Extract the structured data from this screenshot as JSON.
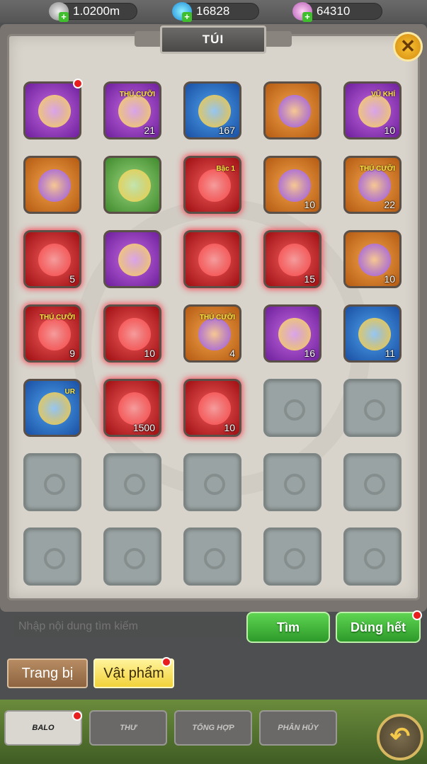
{
  "currencies": [
    {
      "label": "1.0200m",
      "icon": "silver-coin-icon",
      "color": "#bfbfbf"
    },
    {
      "label": "16828",
      "icon": "diamond-icon",
      "color": "#2fb0f0"
    },
    {
      "label": "64310",
      "icon": "pink-gem-icon",
      "color": "#d98ad9"
    }
  ],
  "panel": {
    "title": "TÚI",
    "close_label": "✕"
  },
  "items": [
    {
      "icon": "treasure-chest-icon",
      "color": "purple",
      "count": "",
      "tag": "",
      "badge": true
    },
    {
      "icon": "pet-egg-icon",
      "color": "purple",
      "count": "21",
      "tag": "THÚ CƯỠI",
      "badge": false
    },
    {
      "icon": "gold-flame-icon",
      "color": "blue",
      "count": "167",
      "tag": "",
      "badge": false
    },
    {
      "icon": "gold-orb-icon",
      "color": "orange",
      "count": "",
      "tag": "",
      "badge": false
    },
    {
      "icon": "weapon-egg-icon",
      "color": "purple",
      "count": "10",
      "tag": "VŨ KHÍ",
      "badge": false
    },
    {
      "icon": "puzzle-piece-icon",
      "color": "orange",
      "count": "",
      "tag": "",
      "badge": false
    },
    {
      "icon": "golden-egg-nest-icon",
      "color": "green",
      "count": "",
      "tag": "",
      "badge": false
    },
    {
      "icon": "red-swirl-orb-icon",
      "color": "red",
      "count": "",
      "tag": "Bậc 1",
      "badge": false
    },
    {
      "icon": "purple-orb-icon",
      "color": "orange",
      "count": "10",
      "tag": "",
      "badge": false
    },
    {
      "icon": "blue-fruit-icon",
      "color": "orange",
      "count": "22",
      "tag": "THÚ CƯỠI",
      "badge": false
    },
    {
      "icon": "key-icon",
      "color": "red",
      "count": "5",
      "tag": "",
      "badge": false
    },
    {
      "icon": "red-gem-icon",
      "color": "purple",
      "count": "",
      "tag": "",
      "badge": false
    },
    {
      "icon": "red-orb-icon",
      "color": "red",
      "count": "",
      "tag": "",
      "badge": false
    },
    {
      "icon": "potion-icon",
      "color": "red",
      "count": "15",
      "tag": "",
      "badge": false
    },
    {
      "icon": "rope-icon",
      "color": "orange",
      "count": "10",
      "tag": "",
      "badge": false
    },
    {
      "icon": "candy-icon",
      "color": "red",
      "count": "9",
      "tag": "THÚ CƯỠI",
      "badge": false
    },
    {
      "icon": "blue-scroll-icon",
      "color": "red",
      "count": "10",
      "tag": "",
      "badge": false
    },
    {
      "icon": "scroll-icon",
      "color": "orange",
      "count": "4",
      "tag": "THÚ CƯỠI",
      "badge": false
    },
    {
      "icon": "blue-orb-icon",
      "color": "purple",
      "count": "16",
      "tag": "",
      "badge": false
    },
    {
      "icon": "blue-rope-icon",
      "color": "blue",
      "count": "11",
      "tag": "",
      "badge": false
    },
    {
      "icon": "ur-character-icon",
      "color": "blue",
      "count": "",
      "tag": "UR",
      "badge": false
    },
    {
      "icon": "ruby-icon",
      "color": "red",
      "count": "1500",
      "tag": "",
      "badge": false
    },
    {
      "icon": "green-scroll-icon",
      "color": "red",
      "count": "10",
      "tag": "",
      "badge": false
    },
    {
      "icon": "",
      "color": "empty",
      "count": "",
      "tag": "",
      "badge": false
    },
    {
      "icon": "",
      "color": "empty",
      "count": "",
      "tag": "",
      "badge": false
    },
    {
      "icon": "",
      "color": "empty",
      "count": "",
      "tag": "",
      "badge": false
    },
    {
      "icon": "",
      "color": "empty",
      "count": "",
      "tag": "",
      "badge": false
    },
    {
      "icon": "",
      "color": "empty",
      "count": "",
      "tag": "",
      "badge": false
    },
    {
      "icon": "",
      "color": "empty",
      "count": "",
      "tag": "",
      "badge": false
    },
    {
      "icon": "",
      "color": "empty",
      "count": "",
      "tag": "",
      "badge": false
    },
    {
      "icon": "",
      "color": "empty",
      "count": "",
      "tag": "",
      "badge": false
    },
    {
      "icon": "",
      "color": "empty",
      "count": "",
      "tag": "",
      "badge": false
    },
    {
      "icon": "",
      "color": "empty",
      "count": "",
      "tag": "",
      "badge": false
    },
    {
      "icon": "",
      "color": "empty",
      "count": "",
      "tag": "",
      "badge": false
    },
    {
      "icon": "",
      "color": "empty",
      "count": "",
      "tag": "",
      "badge": false
    }
  ],
  "search": {
    "placeholder": "Nhập nội dung tìm kiếm",
    "search_label": "Tìm",
    "use_all_label": "Dùng hết"
  },
  "filters": {
    "equipment_label": "Trang bị",
    "items_label": "Vật phẩm"
  },
  "tabs": [
    {
      "label": "BALO",
      "active": true,
      "badge": true
    },
    {
      "label": "THƯ",
      "active": false,
      "badge": false
    },
    {
      "label": "TỔNG HỢP",
      "active": false,
      "badge": false
    },
    {
      "label": "PHÂN HỦY",
      "active": false,
      "badge": false
    }
  ],
  "back_label": "↶"
}
